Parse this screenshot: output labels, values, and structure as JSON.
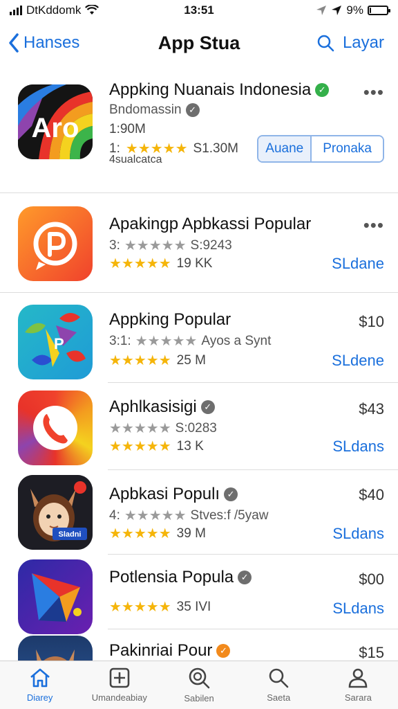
{
  "status_bar": {
    "carrier": "DtKddomk",
    "time": "13:51",
    "battery": "9%",
    "battery_level": 0.09,
    "icons": [
      "signal-icon",
      "wifi-icon",
      "location-icon",
      "battery-icon"
    ]
  },
  "nav": {
    "back_label": "Hanses",
    "title": "App Stua",
    "right_label": "Layar"
  },
  "apps": [
    {
      "name": "Appking Nuanais Indonesia",
      "verified": "green",
      "subtitle": "Bndomassin",
      "size": "1:90M",
      "rating_prefix": "1:",
      "rating_stars": 4.5,
      "rating_count": "S1.30M",
      "category": "4sualcatca",
      "buttons": [
        "Auane",
        "Pronaka"
      ],
      "more": "•••"
    },
    {
      "name": "Apakingp Apbkassi Popular",
      "subtitle_prefix": "3:",
      "subtitle_stars": 4.5,
      "subtitle_value": "S:9243",
      "rating_stars": 4.5,
      "rating_count": "19 KK",
      "action": "SLdane",
      "more": "•••"
    },
    {
      "name": "Appking Popular",
      "subtitle_prefix": "3:1:",
      "subtitle_stars": 4.5,
      "subtitle_value": "Ayos a Synt",
      "rating_stars": 4.5,
      "rating_count": "25 M",
      "price": "$10",
      "action": "SLdene"
    },
    {
      "name": "Aphlkasisigi",
      "verified": "gray",
      "subtitle_prefix": "",
      "subtitle_stars": 4.5,
      "subtitle_value": "S:0283",
      "rating_stars": 4.5,
      "rating_count": "13 K",
      "price": "$43",
      "action": "SLdans"
    },
    {
      "name": "Apbkasi Populı",
      "verified": "gray",
      "subtitle_prefix": "4:",
      "subtitle_stars": 4.5,
      "subtitle_value": "Stves:f /5yaw",
      "rating_stars": 4.5,
      "rating_count": "39 M",
      "price": "$40",
      "action": "SLdans",
      "icon_text": "Sladni"
    },
    {
      "name": "Potlensia Popula",
      "verified": "gray",
      "rating_stars": 4.5,
      "rating_count": "35 IVI",
      "price": "$00",
      "action": "SLdans"
    },
    {
      "name": "Pakinriai Pour",
      "verified": "orange",
      "price": "$15"
    }
  ],
  "tabs": [
    {
      "label": "Diarey",
      "icon": "home-icon",
      "active": true
    },
    {
      "label": "Umandeabiay",
      "icon": "plus-square-icon",
      "active": false
    },
    {
      "label": "Sabilen",
      "icon": "search-circle-icon",
      "active": false
    },
    {
      "label": "Saeta",
      "icon": "search-icon",
      "active": false
    },
    {
      "label": "Sarara",
      "icon": "person-icon",
      "active": false
    }
  ],
  "colors": {
    "accent": "#1a6fdc",
    "star": "#f5b50a",
    "verified_green": "#34b04a",
    "verified_orange": "#f28a1c"
  }
}
